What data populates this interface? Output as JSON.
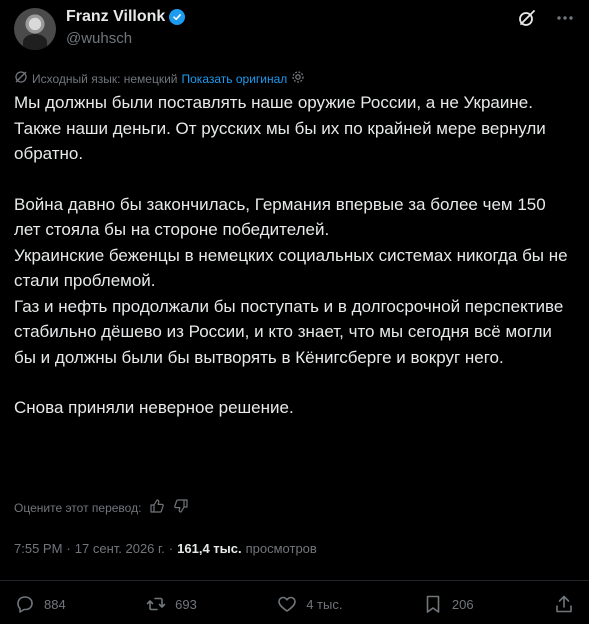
{
  "author": {
    "name": "Franz Villonk",
    "handle": "@wuhsch"
  },
  "translation": {
    "source_text": "Исходный язык: немецкий",
    "show_original": "Показать оригинал"
  },
  "tweet": {
    "line1": "Мы должны были поставлять наше оружие России, а не Украине.",
    "line2": "Также наши деньги. От русских мы бы их по крайней мере вернули обратно.",
    "line3": "Война давно бы закончилась, Германия впервые за более чем 150 лет стояла бы на стороне победителей.",
    "line4": "Украинские беженцы в немецких социальных системах никогда бы не стали проблемой.",
    "line5": "Газ и нефть продолжали бы поступать и в долгосрочной перспективе стабильно дёшево из России, и кто знает, что мы сегодня всё могли бы и должны были бы вытворять в Кёнигсберге и вокруг него.",
    "line6": "Снова приняли неверное решение."
  },
  "rate_translation": "Оцените этот перевод:",
  "meta": {
    "time": "7:55 PM",
    "sep1": "·",
    "date": "17 сент. 2026 г.",
    "sep2": "·",
    "views": "161,4 тыс.",
    "views_label": "просмотров"
  },
  "actions": {
    "replies": "884",
    "reposts": "693",
    "likes": "4 тыс.",
    "bookmarks": "206"
  },
  "colors": {
    "accent": "#1d9bf0",
    "muted": "#71767b",
    "text": "#e7e9ea",
    "background": "#000000"
  },
  "icons": [
    "verified-icon",
    "grok-icon",
    "more-icon",
    "translate-icon",
    "settings-icon",
    "thumbs-up-icon",
    "thumbs-down-icon",
    "reply-icon",
    "repost-icon",
    "like-icon",
    "bookmark-icon",
    "share-icon"
  ]
}
